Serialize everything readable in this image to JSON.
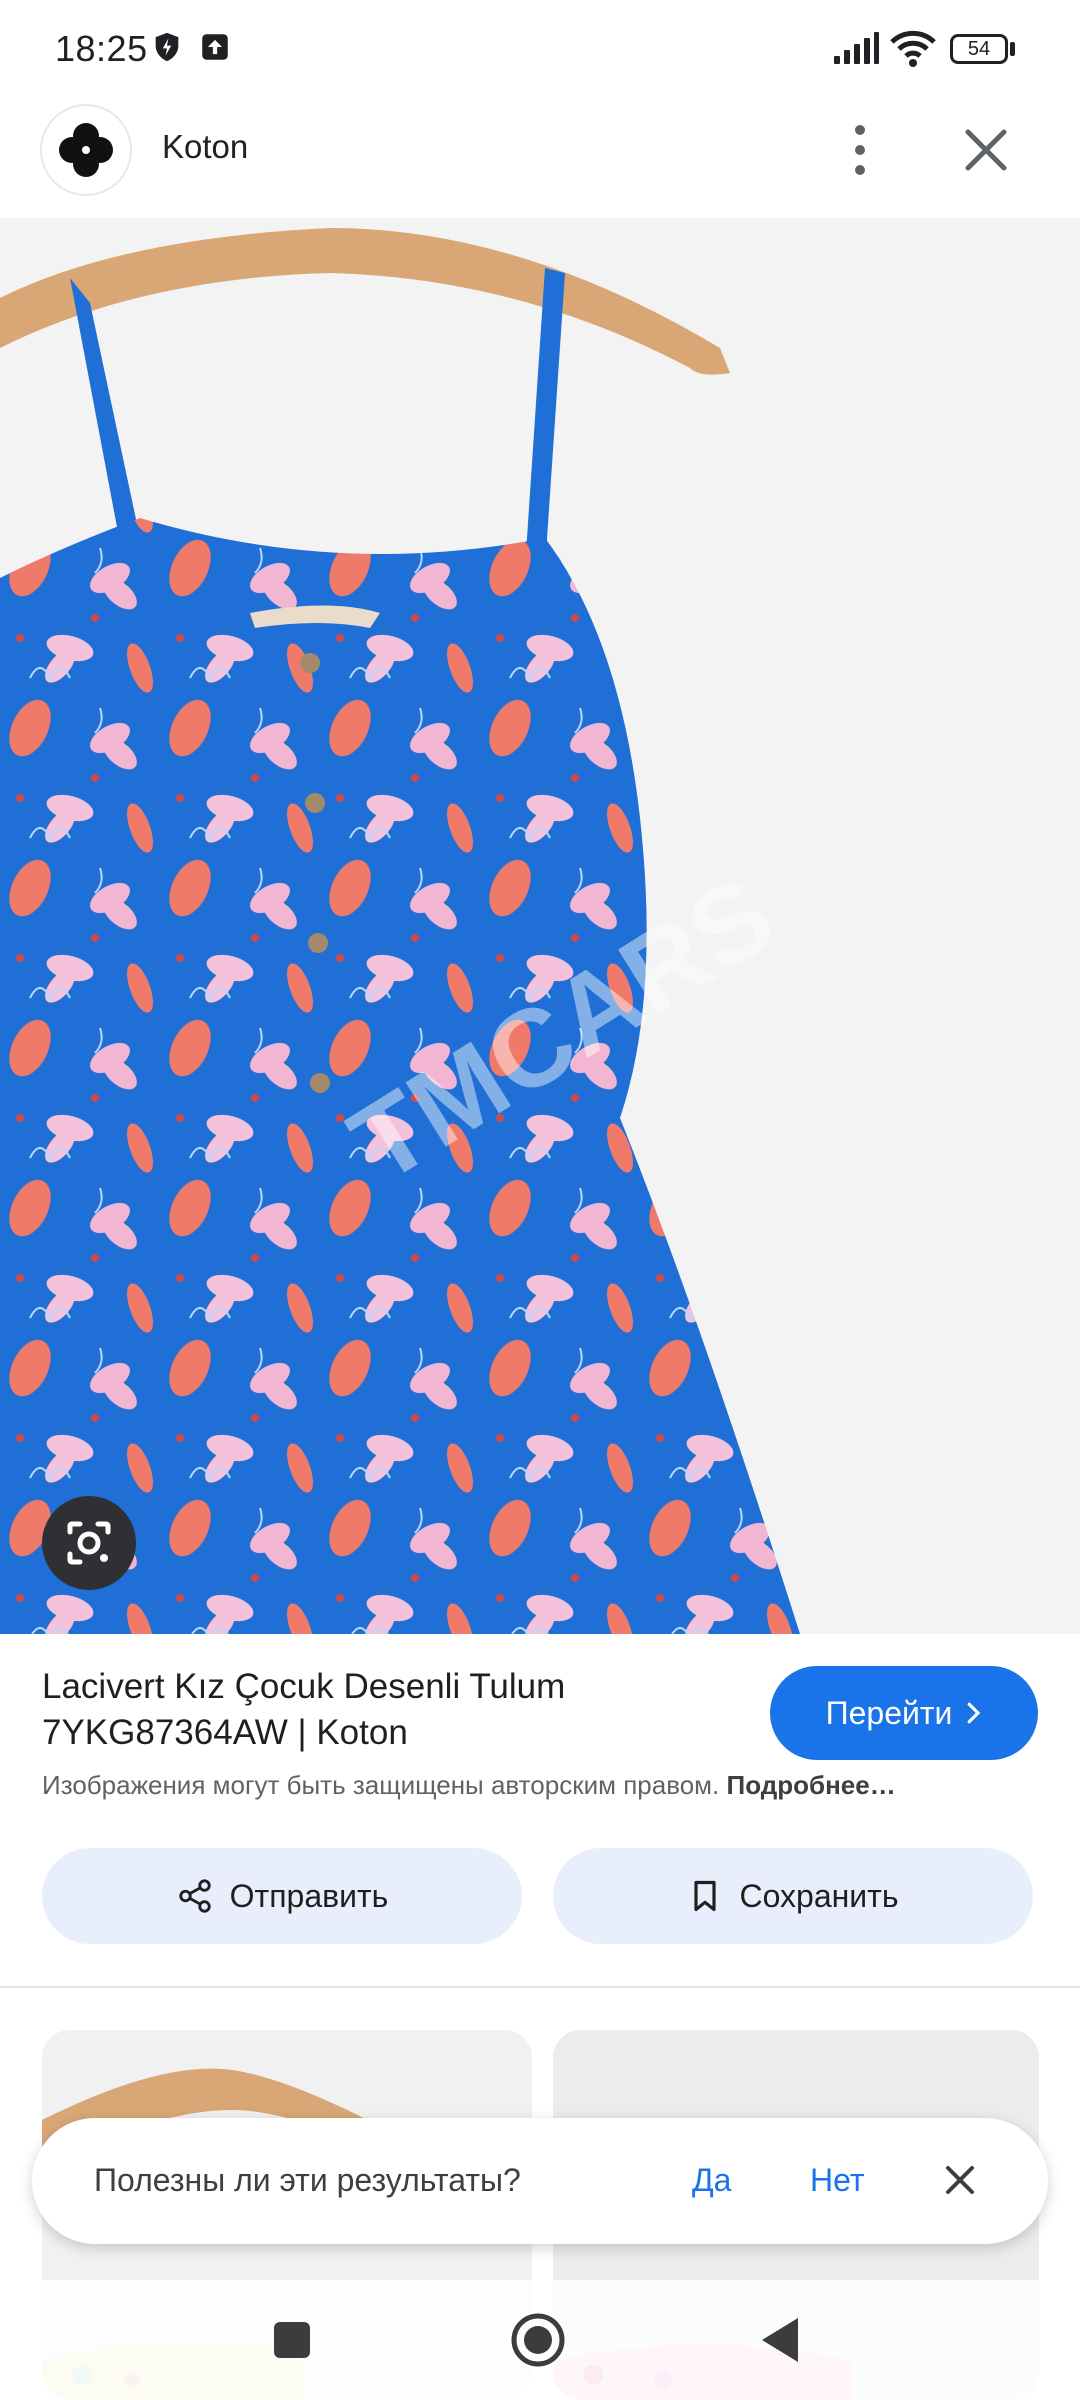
{
  "status": {
    "time": "18:25",
    "battery": "54",
    "icons": [
      "shield-icon",
      "upload-icon",
      "signal-icon",
      "wifi-icon",
      "battery-icon"
    ]
  },
  "header": {
    "site_name": "Koton",
    "logo_icon": "koton-logo-icon",
    "menu_icon": "more-vert-icon",
    "close_icon": "close-icon"
  },
  "hero": {
    "watermark": "TMCARS",
    "lens_icon": "google-lens-icon"
  },
  "result": {
    "title_line1": "Lacivert Kız Çocuk Desenli Tulum",
    "title_line2": "7YKG87364AW | Koton",
    "visit_label": "Перейти",
    "copyright_text": "Изображения могут быть защищены авторским правом.",
    "more_link": "Подробнее…"
  },
  "actions": {
    "share_label": "Отправить",
    "save_label": "Сохранить"
  },
  "feedback": {
    "question": "Полезны ли эти результаты?",
    "yes": "Да",
    "no": "Нет"
  },
  "colors": {
    "accent": "#1a73e8",
    "pill_bg": "#e8eefb",
    "dress_blue": "#1f6fd6"
  }
}
